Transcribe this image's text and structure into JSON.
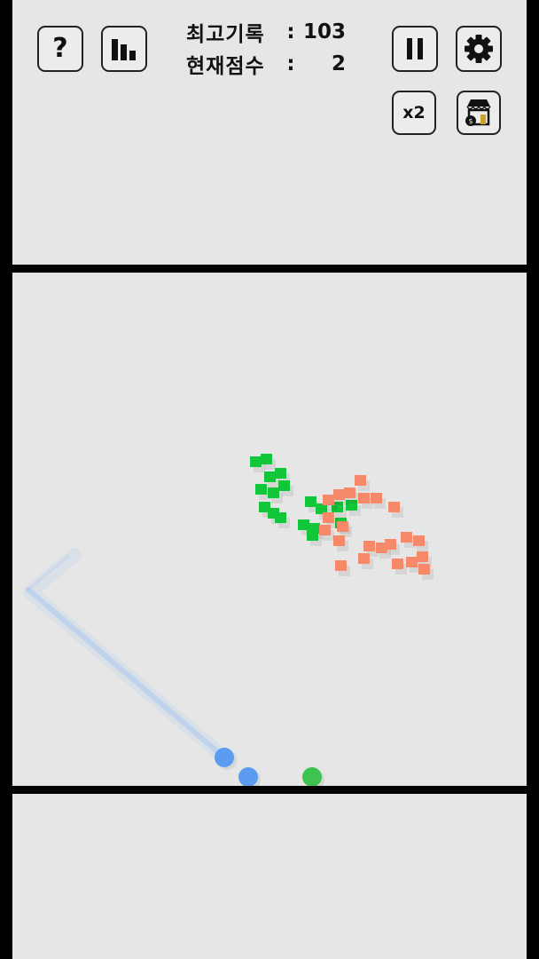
{
  "top": {
    "best_label": "최고기록",
    "best_value": "103",
    "current_label": "현재점수",
    "current_value": "2",
    "colon": ":",
    "help_glyph": "?",
    "multiplier_label": "x2",
    "icons": {
      "help": "question-mark-icon",
      "leaderboard": "bar-chart-icon",
      "pause": "pause-icon",
      "settings": "gear-icon",
      "shop": "shop-icon"
    }
  },
  "colors": {
    "panel_bg": "#e6e6e6",
    "frame": "#000000",
    "ball_blue": "#5b9cf0",
    "ball_green": "#3ec44e",
    "block_green": "#12c639",
    "block_orange": "#f5896a",
    "trajectory": "#a9c8f0"
  },
  "game": {
    "balls": [
      {
        "color": "blue"
      },
      {
        "color": "blue"
      },
      {
        "color": "green"
      }
    ],
    "block_groups": [
      {
        "color": "green"
      },
      {
        "color": "orange"
      }
    ]
  }
}
